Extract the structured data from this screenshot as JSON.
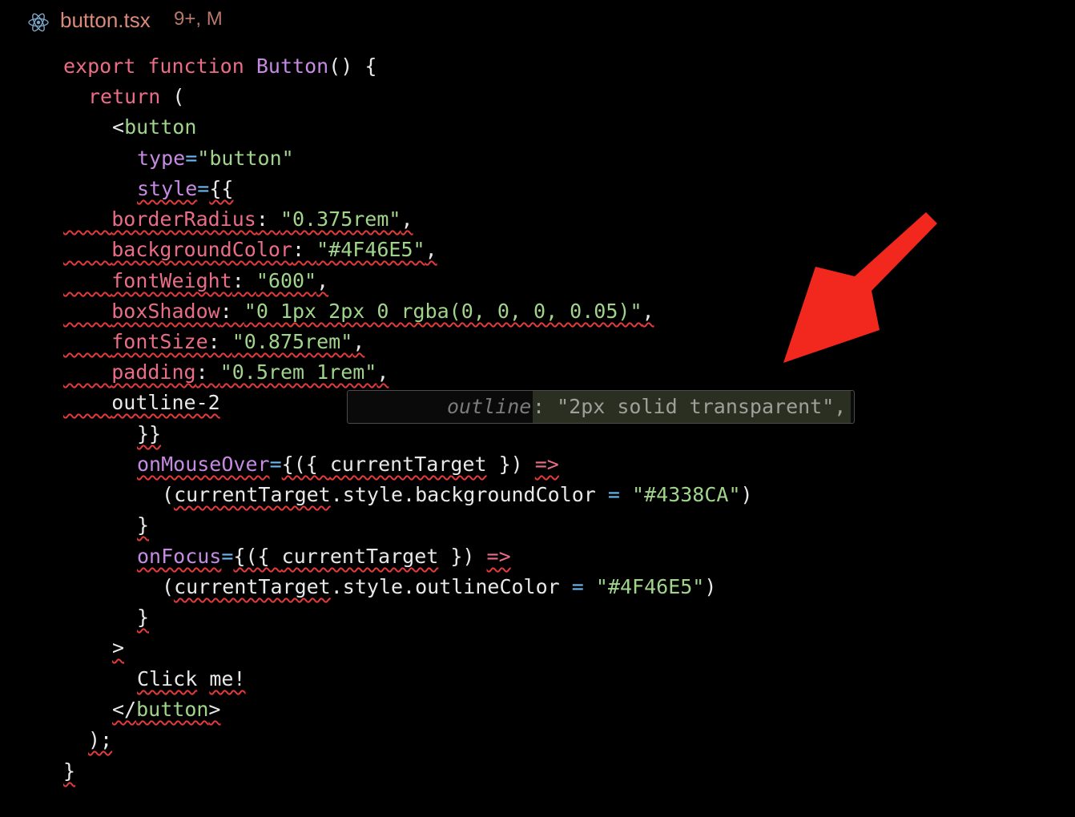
{
  "tab": {
    "icon": "react-icon",
    "filename": "button.tsx",
    "status": "9+, M"
  },
  "code": {
    "l1": {
      "kw1": "export",
      "kw2": "function",
      "name": "Button",
      "rest": "() {"
    },
    "l2": {
      "kw": "return",
      "rest": " ("
    },
    "l3": {
      "open": "<",
      "tag": "button"
    },
    "l4": {
      "attr": "type",
      "eq": "=",
      "val": "\"button\""
    },
    "l5": {
      "attr": "style",
      "eq": "=",
      "brace": "{{"
    },
    "props": [
      {
        "key": "borderRadius",
        "val": "\"0.375rem\"",
        "end": ","
      },
      {
        "key": "backgroundColor",
        "val": "\"#4F46E5\"",
        "end": ","
      },
      {
        "key": "fontWeight",
        "val": "\"600\"",
        "end": ","
      },
      {
        "key": "boxShadow",
        "val": "\"0 1px 2px 0 rgba(0, 0, 0, 0.05)\"",
        "end": ","
      },
      {
        "key": "fontSize",
        "val": "\"0.875rem\"",
        "end": ","
      },
      {
        "key": "padding",
        "val": "\"0.5rem 1rem\"",
        "end": ","
      }
    ],
    "typed": "outline-2",
    "close_style": "}}",
    "mouseover": {
      "attr": "onMouseOver",
      "eq": "=",
      "open": "{({ ",
      "param": "currentTarget",
      "close": " }) ",
      "arrow": "=>"
    },
    "mouseover_body": {
      "pre": "(",
      "expr": "currentTarget",
      "rest": ".style.backgroundColor ",
      "op": "=",
      "val": "\"#4338CA\"",
      "end": ")"
    },
    "brace1": "}",
    "focus": {
      "attr": "onFocus",
      "eq": "=",
      "open": "{({ ",
      "param": "currentTarget",
      "close": " }) ",
      "arrow": "=>"
    },
    "focus_body": {
      "pre": "(",
      "expr": "currentTarget",
      "rest": ".style.outlineColor ",
      "op": "=",
      "val": "\"#4F46E5\"",
      "end": ")"
    },
    "brace2": "}",
    "gt": ">",
    "text": {
      "a": "Click",
      "b": "me!"
    },
    "close_tag": {
      "open": "</",
      "tag": "button",
      "close": ">"
    },
    "paren": ");",
    "final": "}"
  },
  "suggestion": {
    "prop": "outline",
    "rest": ": \"2px solid transparent\","
  },
  "colors": {
    "background": "#000000",
    "keyword": "#ea6d86",
    "function": "#c58be3",
    "string": "#9fd48a",
    "error_squiggle": "#e33b3b",
    "arrow": "#f2281e"
  }
}
